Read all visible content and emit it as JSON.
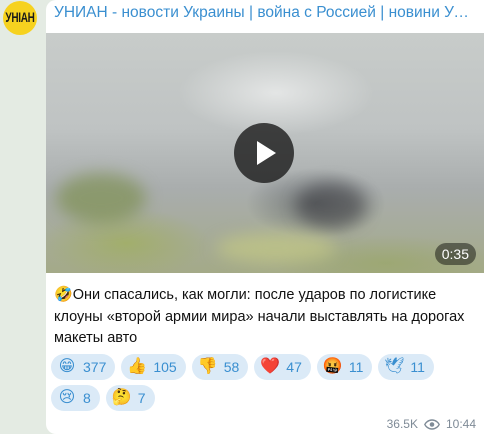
{
  "channel": {
    "avatar_text": "УНІАН",
    "name": "УНИАН - новости Украины | война с Россией | новини Украіни | Україна"
  },
  "video": {
    "duration": "0:35",
    "play_icon": "play-icon"
  },
  "caption": {
    "emoji": "🤣",
    "text": "Они спасались, как могли: после ударов по логистике клоуны «второй армии мира» начали выставлять на дорогах макеты авто"
  },
  "reactions": [
    {
      "emoji": "😁",
      "count": "377"
    },
    {
      "emoji": "👍",
      "count": "105"
    },
    {
      "emoji": "👎",
      "count": "58"
    },
    {
      "emoji": "❤️",
      "count": "47"
    },
    {
      "emoji": "🤬",
      "count": "11"
    },
    {
      "emoji": "🕊",
      "count": "11"
    },
    {
      "emoji": "😢",
      "count": "8"
    },
    {
      "emoji": "🤔",
      "count": "7"
    }
  ],
  "meta": {
    "views": "36.5K",
    "views_icon": "eye-icon",
    "time": "10:44"
  },
  "colors": {
    "accent": "#3a8fd0",
    "reaction_bg": "#dbeaf7",
    "background": "#e4ebe3"
  }
}
